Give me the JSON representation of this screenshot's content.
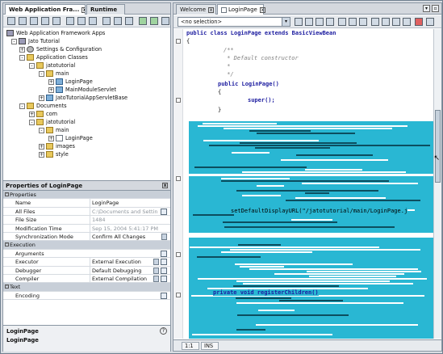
{
  "left_tabs": [
    {
      "label": "Web Application Fra..."
    },
    {
      "label": "Runtime"
    }
  ],
  "tree": [
    {
      "label": "Web Application Framework Apps",
      "icon": "globe-icon"
    },
    {
      "label": "Jato Tutorial",
      "icon": "project-icon"
    },
    {
      "label": "Settings & Configuration",
      "icon": "gear-icon"
    },
    {
      "label": "Application Classes",
      "icon": "folder-icon"
    },
    {
      "label": "jatotutorial",
      "icon": "folder-icon"
    },
    {
      "label": "main",
      "icon": "folder-icon"
    },
    {
      "label": "LoginPage",
      "icon": "class-icon"
    },
    {
      "label": "MainModuleServlet",
      "icon": "class-icon"
    },
    {
      "label": "JatoTutorialAppServletBase",
      "icon": "class-icon"
    },
    {
      "label": "Documents",
      "icon": "folder-icon"
    },
    {
      "label": "com",
      "icon": "folder-icon"
    },
    {
      "label": "jatotutorial",
      "icon": "folder-icon"
    },
    {
      "label": "main",
      "icon": "folder-icon"
    },
    {
      "label": "LoginPage",
      "icon": "page-icon"
    },
    {
      "label": "images",
      "icon": "folder-icon"
    },
    {
      "label": "style",
      "icon": "folder-icon"
    }
  ],
  "properties": {
    "title": "Properties of LoginPage",
    "rows": [
      {
        "key": "Properties",
        "section": true
      },
      {
        "key": "Name",
        "value": "LoginPage"
      },
      {
        "key": "All Files",
        "value": "C:\\Documents and Settin",
        "dim": true,
        "button": true
      },
      {
        "key": "File Size",
        "value": "1484",
        "dim": true
      },
      {
        "key": "Modification Time",
        "value": "Sep 15, 2004 5:41:17 PM",
        "dim": true
      },
      {
        "key": "Synchronization Mode",
        "value": "Confirm All Changes",
        "dropdown": true
      },
      {
        "key": "Execution",
        "section": true
      },
      {
        "key": "Arguments",
        "value": "",
        "button": true
      },
      {
        "key": "Executor",
        "value": "External Execution",
        "button": true,
        "dropdown": true
      },
      {
        "key": "Debugger",
        "value": "Default Debugging",
        "button": true,
        "dropdown": true
      },
      {
        "key": "Compiler",
        "value": "External Compilation",
        "button": true,
        "dropdown": true
      },
      {
        "key": "Text",
        "section": true
      },
      {
        "key": "Encoding",
        "value": "",
        "button": true
      }
    ]
  },
  "left_status": {
    "line1": "LoginPage",
    "line2": "LoginPage"
  },
  "right_tabs": [
    {
      "label": "Welcome"
    },
    {
      "label": "LoginPage"
    }
  ],
  "selector": {
    "value": "<no selection>"
  },
  "code": {
    "class_decl": "public class LoginPage extends BasicViewBean",
    "brace_open": "{",
    "comment_start": "/**",
    "comment_line": " * Default constructor",
    "comment_star": " *",
    "comment_end": " */",
    "ctor": "public LoginPage()",
    "brace2": "{",
    "super_call": "super();",
    "brace3": "}",
    "setdisplay": "setDefaultDisplayURL(\"/jatotutorial/main/LoginPage.j",
    "private_method": "private void registerChildren()"
  },
  "status": {
    "position": "1:1",
    "mode": "INS"
  }
}
